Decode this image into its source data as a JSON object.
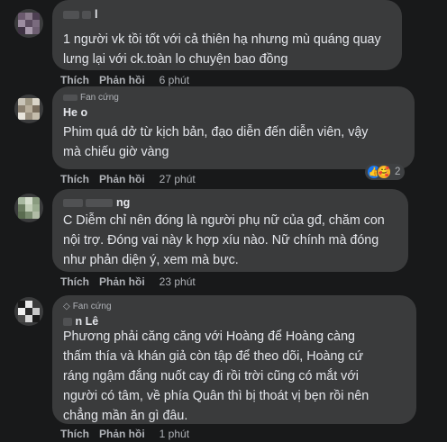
{
  "comments": [
    {
      "name_fragment": "l",
      "badge": "",
      "text_lines": [
        "1 người vk tồi tốt với cả thiên hạ nhưng mù quáng quay",
        "lưng lại với ck.toàn lo chuyện bao đồng"
      ],
      "like_label": "Thích",
      "reply_label": "Phản hồi",
      "time": "6 phút"
    },
    {
      "name_fragment": "He     o",
      "badge": "Fan cứng",
      "text_lines": [
        "Phim quá dở từ kịch bản, đạo diễn đến diễn viên, vậy",
        "mà chiếu giờ vàng"
      ],
      "like_label": "Thích",
      "reply_label": "Phản hồi",
      "time": "27 phút",
      "reaction_count": "2"
    },
    {
      "name_fragment": "ng",
      "badge": "",
      "text_lines": [
        "C Diễm chỉ nên đóng là người phụ nữ của gđ, chăm con",
        "nội trợ. Đóng vai này k hợp xíu nào. Nữ chính mà đóng",
        "như phản diện ý, xem mà bực."
      ],
      "like_label": "Thích",
      "reply_label": "Phản hồi",
      "time": "23 phút"
    },
    {
      "name_fragment": "n Lê",
      "badge": "Fan cứng",
      "text_lines": [
        "Phương phải căng căng với Hoàng để Hoàng càng",
        "thấm thía và khán giả còn tập để theo dõi, Hoàng cứ",
        "ráng ngậm đắng nuốt cay đi rồi trời cũng có mắt với",
        "người có tâm, về phía Quân thì bị thoát vị bẹn rồi nên",
        "chẳng mần ăn gì đâu."
      ],
      "like_label": "Thích",
      "reply_label": "Phản hồi",
      "time": "1 phút"
    }
  ],
  "colors": {
    "background": "#18191a",
    "bubble": "#3a3b3c",
    "text": "#e4e6eb",
    "secondary": "#b0b3b8",
    "like_reaction": "#1877f2",
    "care_reaction": "#f7b125"
  },
  "icons": {
    "badge": "diamond-icon",
    "like": "like-reaction-icon",
    "care": "care-reaction-icon"
  }
}
